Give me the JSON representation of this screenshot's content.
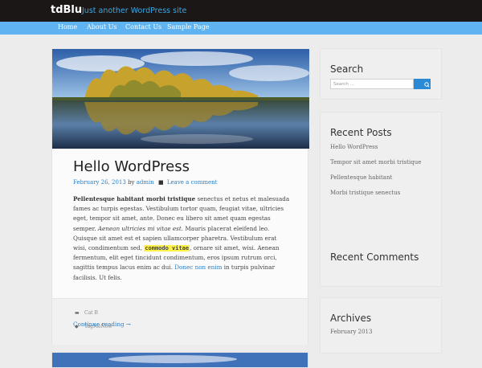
{
  "site": {
    "title": "tdBlu",
    "tagline": "Just another WordPress site"
  },
  "nav": {
    "items": [
      "Home",
      "About Us",
      "Contact Us",
      "Sample Page"
    ]
  },
  "post": {
    "title": "Hello WordPress",
    "date": "February 26, 2013",
    "by": "by",
    "author": "admin",
    "comment_link": "Leave a comment",
    "content": {
      "bold_lead": "Pellentesque habitant morbi tristique",
      "p1": " senectus et netus et malesuada fames ac turpis egestas. Vestibulum tortor quam, feugiat vitae, ultricies eget, tempor sit amet, ante. Donec eu libero sit amet quam egestas semper. ",
      "em": "Aenean ultricies mi vitae est.",
      "p2": " Mauris placerat eleifend leo. Quisque sit amet est et sapien ullamcorper pharetra. Vestibulum erat wisi, condimentum sed, ",
      "code": "commodo vitae",
      "p3": ", ornare sit amet, wisi. Aenean fermentum, elit eget tincidunt condimentum, eros ipsum rutrum orci, sagittis tempus lacus enim ac dui. ",
      "link": "Donec non enim",
      "p4": " in turpis pulvinar facilisis. Ut felis."
    },
    "continue_reading": "Continue reading →",
    "category": "Cat B",
    "tag": "TagMeNow"
  },
  "sidebar": {
    "search": {
      "title": "Search",
      "placeholder": "Search ..."
    },
    "recent_posts": {
      "title": "Recent Posts",
      "items": [
        "Hello WordPress",
        "Tempor sit amet morbi tristique",
        "Pellentesque habitant",
        "Morbi tristique senectus"
      ]
    },
    "recent_comments": {
      "title": "Recent Comments"
    },
    "archives": {
      "title": "Archives",
      "items": [
        "February 2013"
      ]
    }
  },
  "colors": {
    "topbar": "#1c1717",
    "navbar": "#5fb3f0",
    "accent": "#2e7fc0",
    "search_button": "#2b8ad6",
    "highlight": "#fff34a"
  }
}
